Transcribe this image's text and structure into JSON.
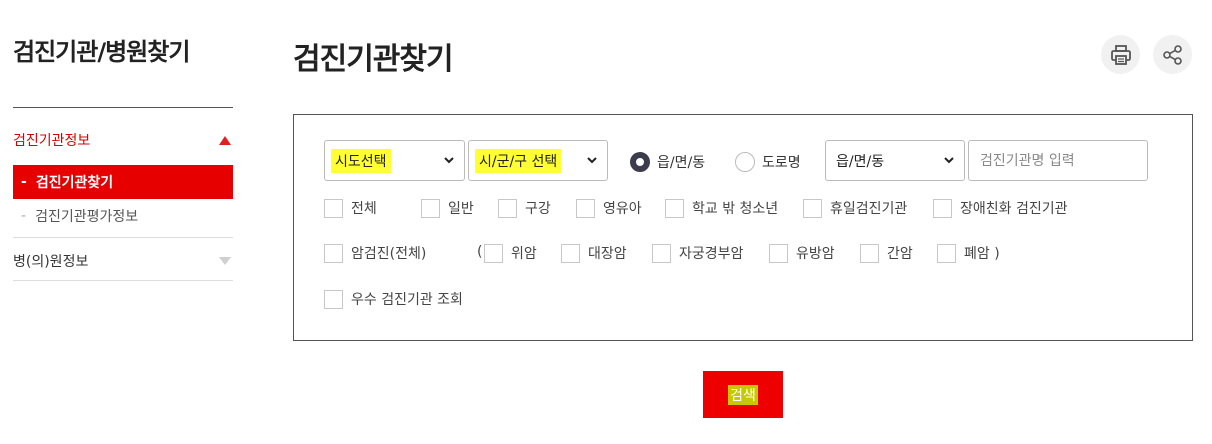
{
  "sidebar": {
    "title": "검진기관/병원찾기",
    "groups": [
      {
        "label": "검진기관정보",
        "expanded": true,
        "items": [
          {
            "label": "검진기관찾기",
            "active": true
          },
          {
            "label": "검진기관평가정보",
            "active": false
          }
        ]
      },
      {
        "label": "병(의)원정보",
        "expanded": false
      }
    ]
  },
  "main": {
    "title": "검진기관찾기",
    "icons": {
      "print": "print-icon",
      "share": "share-icon"
    },
    "search": {
      "sido_select": "시도선택",
      "sigungu_select": "시/군/구 선택",
      "radio_options": [
        {
          "label": "읍/면/동",
          "checked": true
        },
        {
          "label": "도로명",
          "checked": false
        }
      ],
      "dong_select": "읍/면/동",
      "name_placeholder": "검진기관명 입력",
      "checkbox_row1": [
        "전체",
        "일반",
        "구강",
        "영유아",
        "학교 밖 청소년",
        "휴일검진기관",
        "장애친화 검진기관"
      ],
      "cancer_all": "암검진(전체)",
      "paren_open": "(",
      "cancer_items": [
        "위암",
        "대장암",
        "자궁경부암",
        "유방암",
        "간암",
        "폐암 )"
      ],
      "excellent": "우수 검진기관 조회"
    },
    "submit_label": "검색"
  },
  "colors": {
    "accent": "#e60000",
    "highlight": "#ffff33",
    "border": "#555555"
  }
}
